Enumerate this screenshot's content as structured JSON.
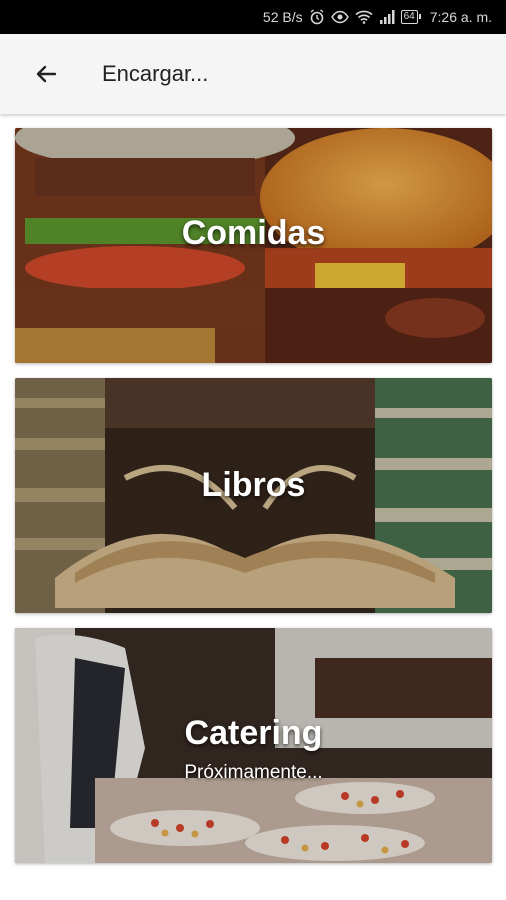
{
  "status": {
    "speed": "52 B/s",
    "battery": "64",
    "time": "7:26 a. m."
  },
  "appbar": {
    "title": "Encargar..."
  },
  "cards": [
    {
      "label": "Comidas"
    },
    {
      "label": "Libros"
    },
    {
      "label": "Catering",
      "subtitle": "Próximamente..."
    }
  ]
}
